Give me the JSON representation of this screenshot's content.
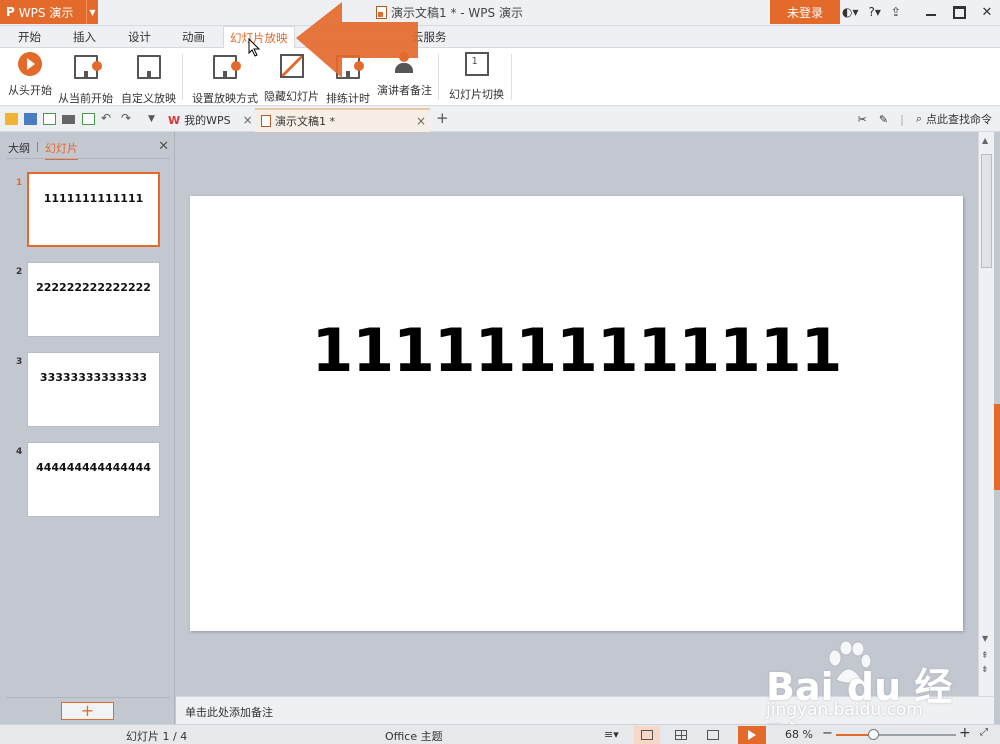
{
  "titlebar": {
    "app_name": "WPS 演示",
    "logo": "P",
    "doc_title": "演示文稿1 * - WPS 演示",
    "login": "未登录",
    "help": "?",
    "icons": [
      "skin-icon",
      "help-icon",
      "upload-icon"
    ]
  },
  "ribbon_tabs": [
    "开始",
    "插入",
    "设计",
    "动画",
    "幻灯片放映",
    "云服务"
  ],
  "active_tab": "幻灯片放映",
  "ribbon_buttons": [
    "从头开始",
    "从当前开始",
    "自定义放映",
    "设置放映方式",
    "隐藏幻灯片",
    "排练计时",
    "演讲者备注",
    "幻灯片切换"
  ],
  "doc_tabs": [
    {
      "label": "我的WPS",
      "active": false
    },
    {
      "label": "演示文稿1 *",
      "active": true
    }
  ],
  "search_command": "点此查找命令",
  "left_pane": {
    "tab_outline": "大纲",
    "tab_slides": "幻灯片",
    "slides": [
      {
        "num": "1",
        "text": "1111111111111",
        "selected": true
      },
      {
        "num": "2",
        "text": "222222222222222",
        "selected": false
      },
      {
        "num": "3",
        "text": "33333333333333",
        "selected": false
      },
      {
        "num": "4",
        "text": "444444444444444",
        "selected": false
      }
    ],
    "add_label": "+"
  },
  "slide": {
    "text": "1111111111111"
  },
  "notes_placeholder": "单击此处添加备注",
  "statusbar": {
    "slide_counter": "幻灯片 1 / 4",
    "theme": "Office 主题",
    "zoom": "68 %",
    "zoom_minus": "−",
    "zoom_plus": "+",
    "zoom_fraction": 0.31
  },
  "watermark": {
    "brand": "Bai du 经验",
    "url": "jingyan.baidu.com"
  },
  "colors": {
    "accent": "#e46a2c",
    "canvas_bg": "#c3c7d0"
  }
}
